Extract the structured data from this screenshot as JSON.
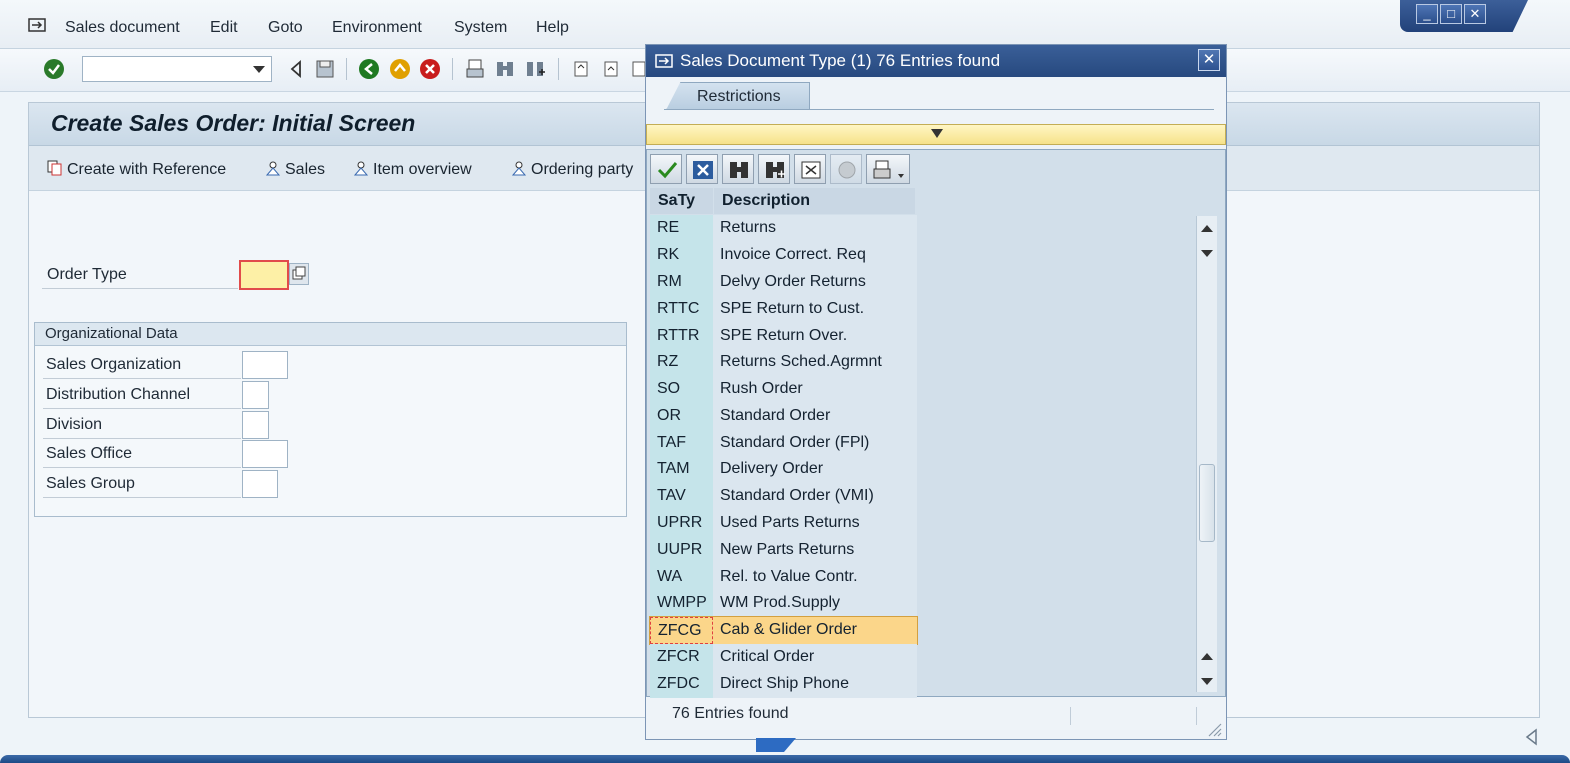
{
  "menu": {
    "items": [
      {
        "label": "Sales document",
        "ul": "S"
      },
      {
        "label": "Edit",
        "ul": "E"
      },
      {
        "label": "Goto",
        "ul": "G"
      },
      {
        "label": "Environment",
        "ul": "v"
      },
      {
        "label": "System",
        "ul": "y"
      },
      {
        "label": "Help",
        "ul": "H"
      }
    ]
  },
  "toolbar": {
    "command_field_value": ""
  },
  "screen": {
    "title": "Create Sales Order: Initial Screen",
    "app_buttons": [
      "Create with Reference",
      "Sales",
      "Item overview",
      "Ordering party"
    ],
    "order_type_label": "Order Type",
    "order_type_value": "",
    "org_group_title": "Organizational Data",
    "org_fields": [
      {
        "label": "Sales Organization",
        "value": ""
      },
      {
        "label": "Distribution Channel",
        "value": ""
      },
      {
        "label": "Division",
        "value": ""
      },
      {
        "label": "Sales Office",
        "value": ""
      },
      {
        "label": "Sales Group",
        "value": ""
      }
    ]
  },
  "dialog": {
    "title": "Sales Document Type (1)   76 Entries found",
    "tab_label": "Restrictions",
    "col_headers": [
      "SaTy",
      "Description"
    ],
    "rows": [
      {
        "code": "RE",
        "desc": "Returns"
      },
      {
        "code": "RK",
        "desc": "Invoice Correct. Req"
      },
      {
        "code": "RM",
        "desc": "Delvy Order Returns"
      },
      {
        "code": "RTTC",
        "desc": "SPE Return to Cust."
      },
      {
        "code": "RTTR",
        "desc": "SPE Return Over."
      },
      {
        "code": "RZ",
        "desc": "Returns Sched.Agrmnt"
      },
      {
        "code": "SO",
        "desc": "Rush Order"
      },
      {
        "code": "OR",
        "desc": "Standard Order"
      },
      {
        "code": "TAF",
        "desc": "Standard Order (FPl)"
      },
      {
        "code": "TAM",
        "desc": "Delivery Order"
      },
      {
        "code": "TAV",
        "desc": "Standard Order (VMI)"
      },
      {
        "code": "UPRR",
        "desc": "Used Parts Returns"
      },
      {
        "code": "UUPR",
        "desc": "New Parts Returns"
      },
      {
        "code": "WA",
        "desc": "Rel. to Value Contr."
      },
      {
        "code": "WMPP",
        "desc": "WM Prod.Supply"
      },
      {
        "code": "ZFCG",
        "desc": "Cab & Glider Order",
        "selected": true
      },
      {
        "code": "ZFCR",
        "desc": "Critical Order"
      },
      {
        "code": "ZFDC",
        "desc": "Direct Ship Phone"
      }
    ],
    "status_text": "76 Entries found"
  },
  "colors": {
    "title_bar": "#27497f",
    "selected_row": "#fbd68a",
    "required_field": "#fdf0a6",
    "key_column": "#c5e4ea"
  }
}
